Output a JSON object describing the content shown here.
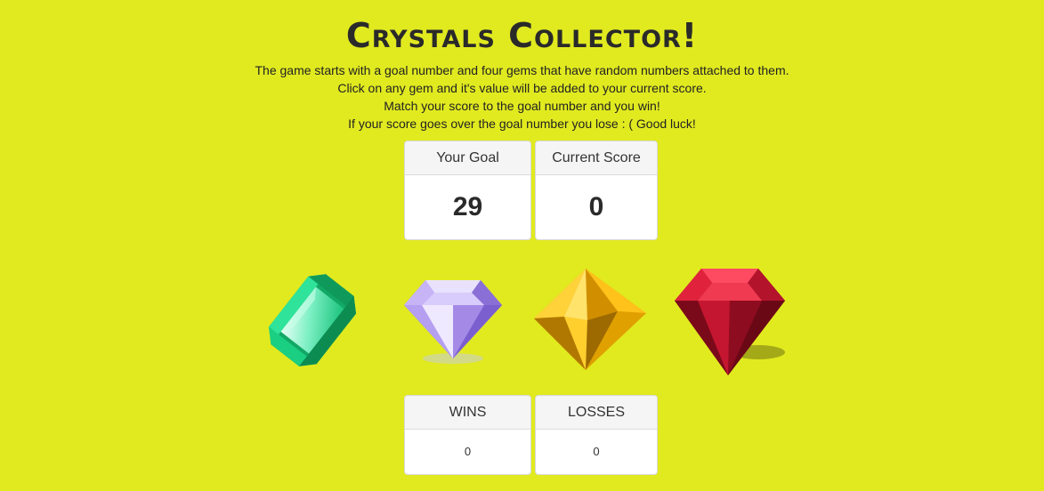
{
  "title": "Crystals Collector!",
  "instructions": [
    "The game starts with a goal number and four gems that have random numbers attached to them.",
    "Click on any gem and it's value will be added to your current score.",
    "Match your score to the goal number and you win!",
    "If your score goes over the goal number you lose : ( Good luck!"
  ],
  "goal": {
    "label": "Your Goal",
    "value": "29"
  },
  "current_score": {
    "label": "Current Score",
    "value": "0"
  },
  "gems": [
    {
      "name": "green-gem-icon",
      "color": "#1fcf86"
    },
    {
      "name": "purple-diamond-icon",
      "color": "#a78ae6"
    },
    {
      "name": "yellow-gem-icon",
      "color": "#f2b300"
    },
    {
      "name": "red-gem-icon",
      "color": "#c8102e"
    }
  ],
  "wins": {
    "label": "WINS",
    "value": "0"
  },
  "losses": {
    "label": "LOSSES",
    "value": "0"
  },
  "colors": {
    "background": "#e1ea1f",
    "panel": "#ffffff",
    "panel_heading": "#f5f5f5"
  }
}
